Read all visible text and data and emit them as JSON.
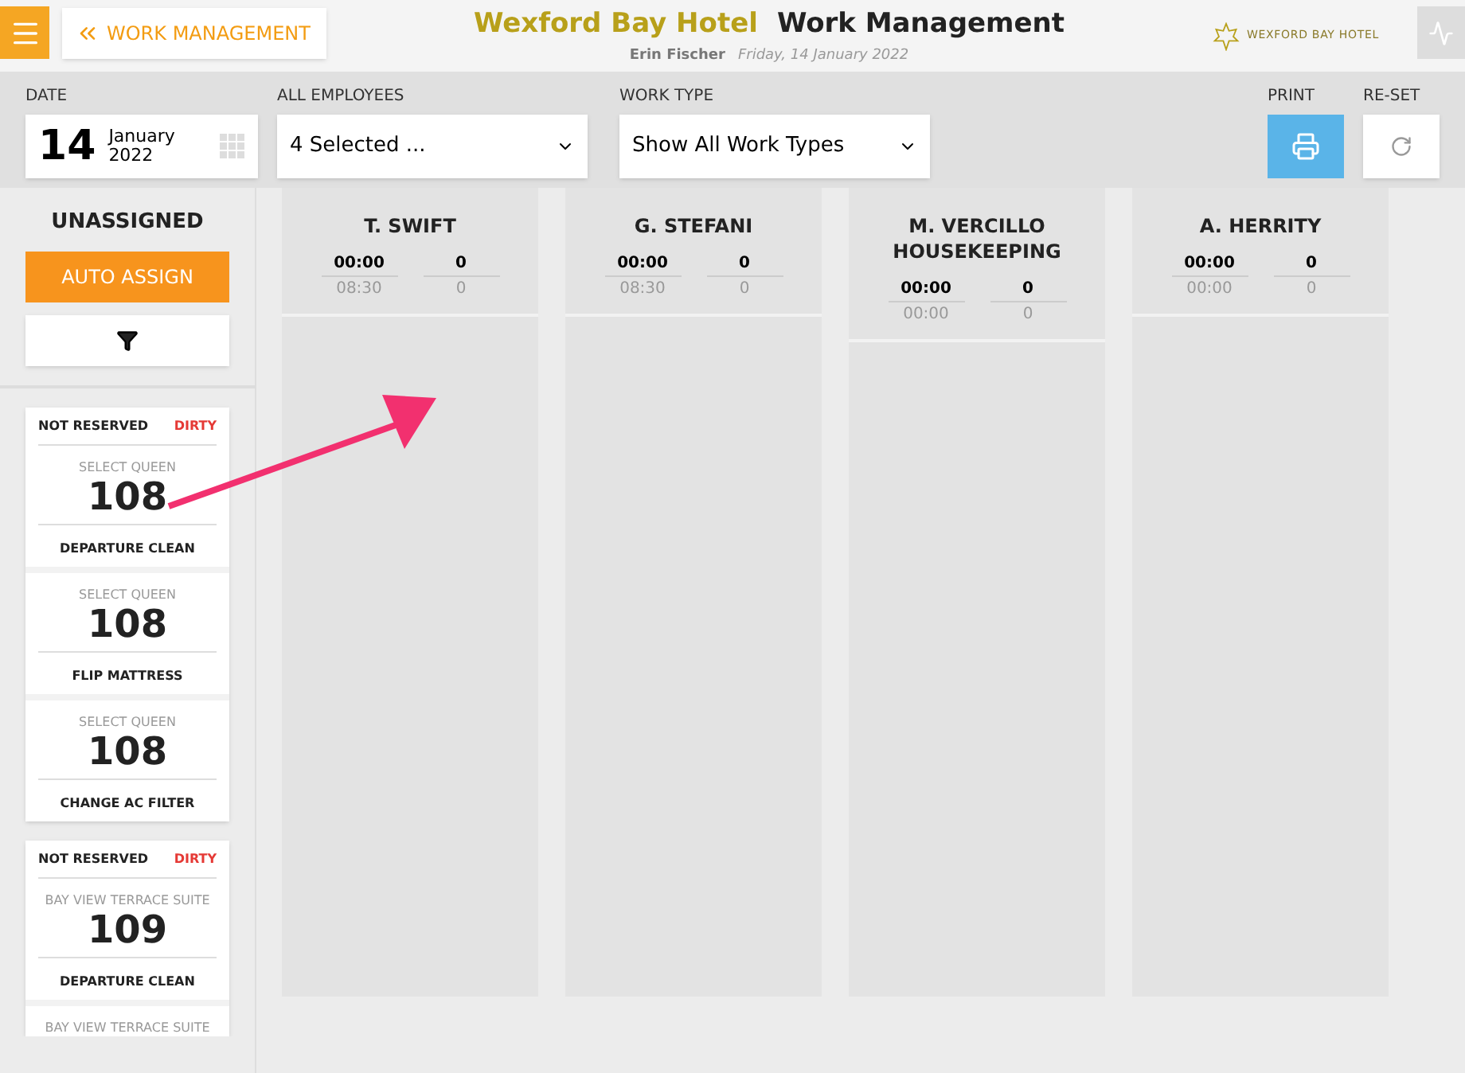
{
  "header": {
    "back_label": "WORK MANAGEMENT",
    "hotel": "Wexford Bay Hotel",
    "title": "Work Management",
    "user": "Erin Fischer",
    "date": "Friday, 14 January 2022",
    "logo_text": "WEXFORD BAY HOTEL"
  },
  "toolbar": {
    "date_label": "DATE",
    "day": "14",
    "month": "January",
    "year": "2022",
    "employees_label": "ALL EMPLOYEES",
    "employees_value": "4 Selected ...",
    "work_type_label": "WORK TYPE",
    "work_type_value": "Show All Work Types",
    "print_label": "PRINT",
    "reset_label": "RE-SET"
  },
  "unassigned": {
    "title": "UNASSIGNED",
    "auto_assign": "AUTO ASSIGN",
    "rooms": [
      {
        "reservation": "NOT RESERVED",
        "status": "DIRTY",
        "color": "#e53935",
        "tasks": [
          {
            "room_type": "SELECT QUEEN",
            "number": "108",
            "task": "DEPARTURE CLEAN"
          },
          {
            "room_type": "SELECT QUEEN",
            "number": "108",
            "task": "FLIP MATTRESS"
          },
          {
            "room_type": "SELECT QUEEN",
            "number": "108",
            "task": "CHANGE AC FILTER"
          }
        ]
      },
      {
        "reservation": "NOT RESERVED",
        "status": "DIRTY",
        "color": "#e53935",
        "tasks": [
          {
            "room_type": "BAY VIEW TERRACE SUITE",
            "number": "109",
            "task": "DEPARTURE CLEAN"
          },
          {
            "room_type": "BAY VIEW TERRACE SUITE"
          }
        ]
      }
    ]
  },
  "employees": [
    {
      "name": "T. SWIFT",
      "time": "00:00",
      "count": "0",
      "planned_time": "08:30",
      "planned_count": "0"
    },
    {
      "name": "G. STEFANI",
      "time": "00:00",
      "count": "0",
      "planned_time": "08:30",
      "planned_count": "0"
    },
    {
      "name": "M. VERCILLO HOUSEKEEPING",
      "time": "00:00",
      "count": "0",
      "planned_time": "00:00",
      "planned_count": "0"
    },
    {
      "name": "A. HERRITY",
      "time": "00:00",
      "count": "0",
      "planned_time": "00:00",
      "planned_count": "0"
    }
  ]
}
